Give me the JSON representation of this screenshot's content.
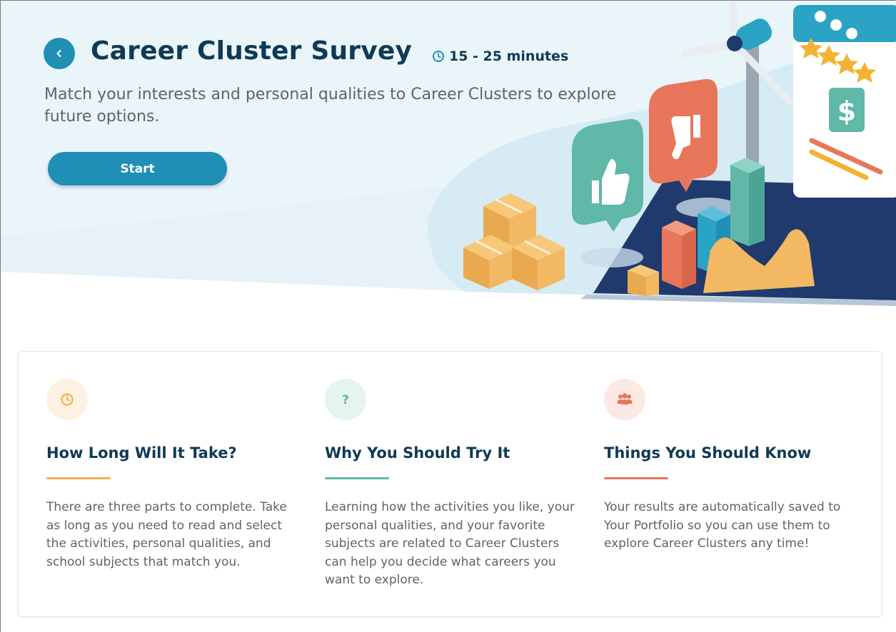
{
  "header": {
    "back_icon": "chevron-left-icon",
    "title": "Career Cluster Survey",
    "duration_icon": "clock-icon",
    "duration": "15 - 25 minutes",
    "subtitle_line1": "Match your interests and personal qualities to Career Clusters to explore",
    "subtitle_line2": "future options.",
    "start_label": "Start"
  },
  "colors": {
    "primary": "#1f8fb5",
    "heading": "#0f3a55",
    "orange": "#f0b14c",
    "teal": "#5fb8a8",
    "coral": "#e8765a"
  },
  "info": {
    "items": [
      {
        "icon": "clock-icon",
        "heading": "How Long Will It Take?",
        "text": "There are three parts to complete. Take as long as you need to read and select the activities, personal qualities, and school subjects that match you."
      },
      {
        "icon": "question-icon",
        "heading": "Why You Should Try It",
        "text": "Learning how the activities you like, your personal qualities, and your favorite subjects are related to Career Clusters can help you decide what careers you want to explore."
      },
      {
        "icon": "users-icon",
        "heading": "Things You Should Know",
        "text": "Your results are automatically saved to Your Portfolio so you can use them to explore Career Clusters any time!"
      }
    ]
  }
}
